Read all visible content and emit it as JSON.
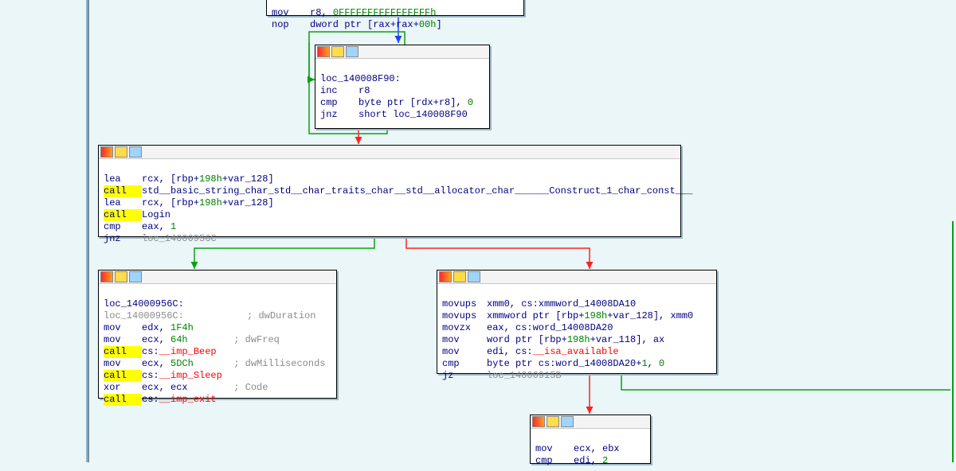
{
  "colors": {
    "node_border": "#000",
    "bg": "#eaf6f8",
    "mnemonic": "#000080",
    "immediate": "#008000",
    "comment": "#8a8a8a",
    "highlight": "#ffff00",
    "edge_true": "#0aa010",
    "edge_false": "#ff2020",
    "edge_jmp": "#2040ff"
  },
  "icons": [
    "graph-color-icon",
    "edit-icon",
    "record-icon"
  ],
  "nodes": {
    "top": {
      "lines": [
        {
          "op": "mov",
          "args": [
            "r8, ",
            "0FFFFFFFFFFFFFFFFh"
          ]
        },
        {
          "op": "nop",
          "args": [
            "dword ptr [rax+rax+",
            "00h",
            "]"
          ]
        }
      ]
    },
    "loop": {
      "label": "loc_140008F90:",
      "lines": [
        {
          "op": "inc",
          "args": [
            "r8"
          ]
        },
        {
          "op": "cmp",
          "args": [
            "byte ptr [rdx+r8], ",
            "0"
          ]
        },
        {
          "op": "jnz",
          "args": [
            "short loc_140008F90"
          ]
        }
      ]
    },
    "construct": {
      "lines": [
        {
          "op": "lea",
          "args": [
            "rcx, [rbp+",
            "198h",
            "+var_128]"
          ]
        },
        {
          "op": "call",
          "hi": true,
          "args": [
            "std__basic_string_char_std__char_traits_char__std__allocator_char______Construct_1_char_const___"
          ]
        },
        {
          "op": "lea",
          "args": [
            "rcx, [rbp+",
            "198h",
            "+var_128]"
          ]
        },
        {
          "op": "call",
          "hi": true,
          "args": [
            "Login"
          ]
        },
        {
          "op": "cmp",
          "args": [
            "eax, ",
            "1"
          ]
        },
        {
          "op": "jnz",
          "args": [
            "loc_14000956C"
          ],
          "gray": true
        }
      ]
    },
    "left": {
      "label": "loc_14000956C:",
      "xref": "loc_14000956C:",
      "lines": [
        {
          "cmt": "; dwDuration"
        },
        {
          "op": "mov",
          "args": [
            "edx, ",
            "1F4h"
          ]
        },
        {
          "op": "mov",
          "args": [
            "ecx, ",
            "64h"
          ],
          "cmt": "; dwFreq"
        },
        {
          "op": "call",
          "hi": true,
          "args": [
            "cs:",
            "__imp_Beep"
          ],
          "pink": true
        },
        {
          "op": "mov",
          "args": [
            "ecx, ",
            "5DCh"
          ],
          "cmt": "; dwMilliseconds"
        },
        {
          "op": "call",
          "hi": true,
          "args": [
            "cs:",
            "__imp_Sleep"
          ],
          "pink": true
        },
        {
          "op": "xor",
          "args": [
            "ecx, ecx"
          ],
          "cmt": "; Code"
        },
        {
          "op": "call",
          "hi": true,
          "args": [
            "cs:",
            "__imp_exit"
          ],
          "pink": true
        }
      ]
    },
    "right": {
      "lines": [
        {
          "op": "movups",
          "args": [
            "xmm0, cs:xmmword_14008DA10"
          ]
        },
        {
          "op": "movups",
          "args": [
            "xmmword ptr [rbp+",
            "198h",
            "+var_128], xmm0"
          ]
        },
        {
          "op": "movzx",
          "args": [
            "eax, cs:word_14008DA20"
          ]
        },
        {
          "op": "mov",
          "args": [
            "word ptr [rbp+",
            "198h",
            "+var_118], ax"
          ]
        },
        {
          "op": "mov",
          "args": [
            "edi, cs:",
            "__isa_available"
          ],
          "pink": true
        },
        {
          "op": "cmp",
          "args": [
            "byte ptr cs:word_14008DA20+",
            "1",
            ", ",
            "0"
          ]
        },
        {
          "op": "jz",
          "args": [
            "loc_14000915B"
          ],
          "gray": true
        }
      ]
    },
    "bottom": {
      "lines": [
        {
          "op": "mov",
          "args": [
            "ecx, ebx"
          ]
        },
        {
          "op": "cmp",
          "args": [
            "edi, ",
            "2"
          ]
        }
      ]
    }
  },
  "edges": [
    {
      "from": "top",
      "to": "loop",
      "kind": "jmp"
    },
    {
      "from": "loop",
      "to": "loop",
      "kind": "true",
      "self": true
    },
    {
      "from": "loop",
      "to": "construct",
      "kind": "false"
    },
    {
      "from": "construct",
      "to": "left",
      "kind": "true"
    },
    {
      "from": "construct",
      "to": "right",
      "kind": "false"
    },
    {
      "from": "right",
      "to": "bottom",
      "kind": "false"
    },
    {
      "from": "right",
      "to": "offscreen",
      "kind": "true"
    }
  ]
}
